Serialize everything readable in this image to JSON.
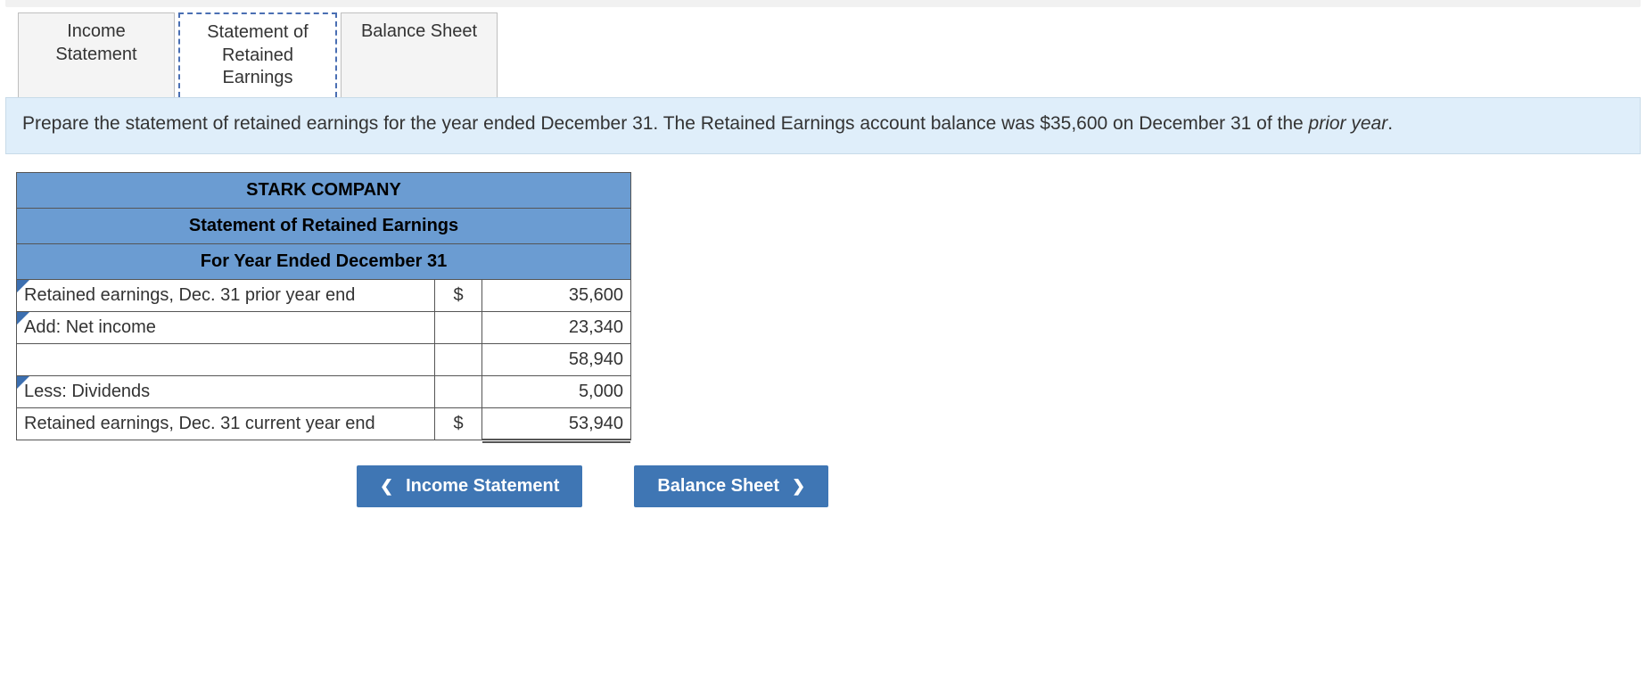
{
  "tabs": {
    "income_statement": "Income\nStatement",
    "retained_earnings": "Statement of\nRetained\nEarnings",
    "balance_sheet": "Balance Sheet"
  },
  "instructions": {
    "text_a": "Prepare the statement of retained earnings for the year ended December 31. The Retained Earnings account balance was $35,600 on December 31 of the ",
    "em": "prior year",
    "text_b": "."
  },
  "statement": {
    "company": "STARK COMPANY",
    "title": "Statement of Retained Earnings",
    "period": "For Year Ended December 31",
    "rows": [
      {
        "label": "Retained earnings, Dec. 31 prior year end",
        "symbol": "$",
        "value": "35,600",
        "dropdown": true
      },
      {
        "label": "Add: Net income",
        "symbol": "",
        "value": "23,340",
        "dropdown": true
      },
      {
        "label": "",
        "symbol": "",
        "value": "58,940",
        "dropdown": false
      },
      {
        "label": "Less: Dividends",
        "symbol": "",
        "value": "5,000",
        "dropdown": true
      },
      {
        "label": "Retained earnings, Dec. 31 current year end",
        "symbol": "$",
        "value": "53,940",
        "dropdown": false,
        "double": true
      }
    ]
  },
  "nav": {
    "prev": "Income Statement",
    "next": "Balance Sheet"
  }
}
